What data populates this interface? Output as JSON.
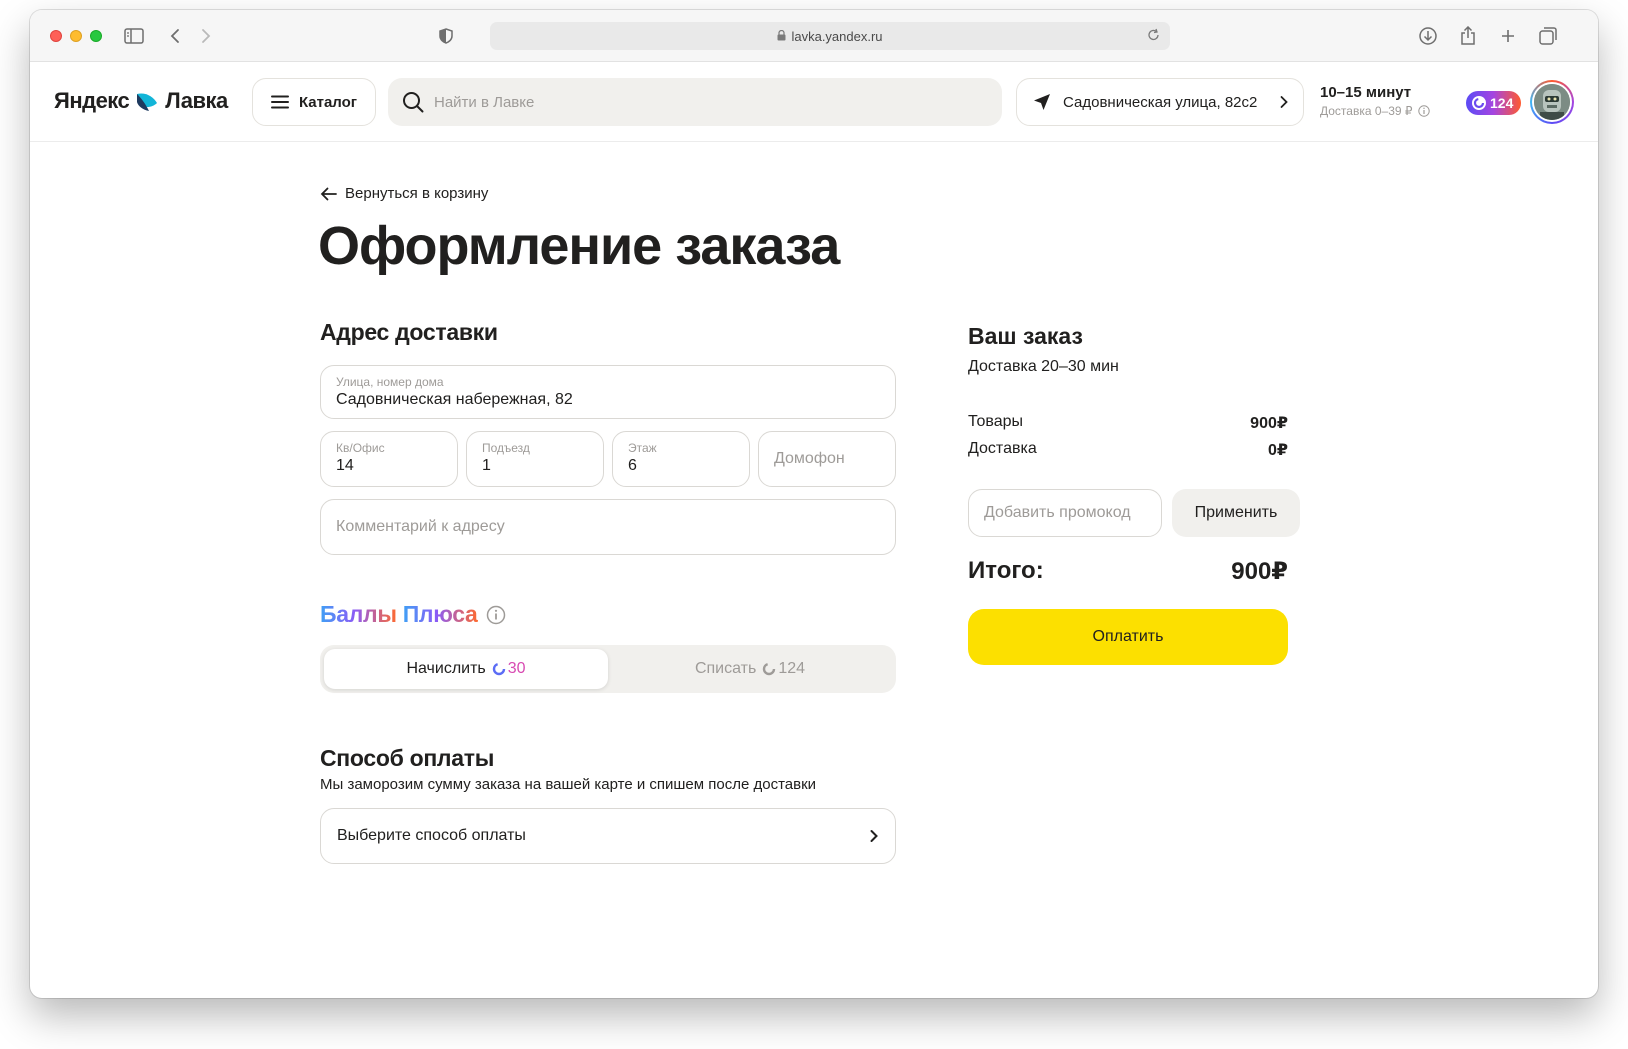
{
  "browser": {
    "url": "lavka.yandex.ru"
  },
  "header": {
    "logo_left": "Яндекс",
    "logo_right": "Лавка",
    "catalog_label": "Каталог",
    "search_placeholder": "Найти в Лавке",
    "address": "Садовническая улица, 82с2",
    "delivery_time": "10–15 минут",
    "delivery_cost": "Доставка 0–39 ₽",
    "plus_points": "124"
  },
  "page": {
    "back_label": "Вернуться в корзину",
    "title": "Оформление заказа"
  },
  "address_section": {
    "title": "Адрес доставки",
    "street_label": "Улица, номер дома",
    "street_value": "Садовническая набережная, 82",
    "apt_label": "Кв/Офис",
    "apt_value": "14",
    "entrance_label": "Подъезд",
    "entrance_value": "1",
    "floor_label": "Этаж",
    "floor_value": "6",
    "intercom_placeholder": "Домофон",
    "comment_placeholder": "Комментарий к адресу"
  },
  "plus_section": {
    "title_part1": "Баллы",
    "title_part2": "Плюса",
    "earn_label": "Начислить",
    "earn_points": "30",
    "spend_label": "Списать",
    "spend_points": "124"
  },
  "payment_section": {
    "title": "Способ оплаты",
    "subtitle": "Мы заморозим сумму заказа на вашей карте и спишем после доставки",
    "select_label": "Выберите способ оплаты"
  },
  "order": {
    "title": "Ваш заказ",
    "delivery_eta": "Доставка 20–30 мин",
    "goods_label": "Товары",
    "goods_value": "900₽",
    "delivery_label": "Доставка",
    "delivery_value": "0₽",
    "promo_placeholder": "Добавить промокод",
    "promo_apply": "Применить",
    "total_label": "Итого:",
    "total_value": "900₽",
    "pay_label": "Оплатить"
  },
  "colors": {
    "accent_yellow": "#fce000",
    "text_primary": "#21201f",
    "text_secondary": "#9e9b98",
    "surface_gray": "#f1f0ed"
  }
}
